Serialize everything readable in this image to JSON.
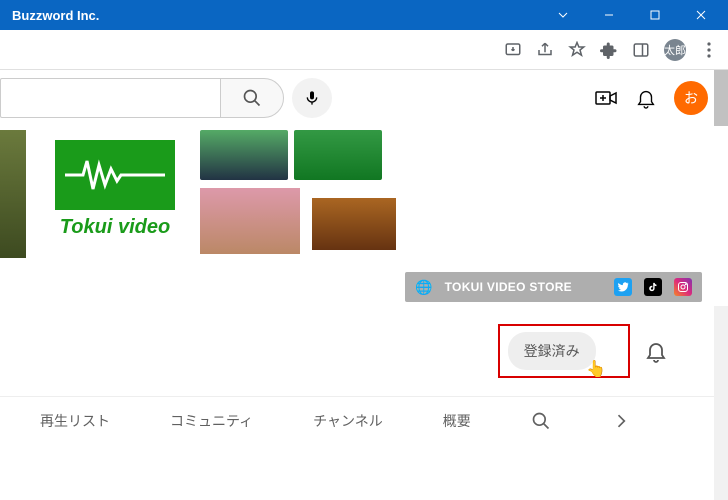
{
  "window": {
    "title": "Buzzword Inc."
  },
  "browser": {
    "profile_label": "太郎"
  },
  "youtube": {
    "avatar_label": "お",
    "channel_name": "Tokui video",
    "store_link_label": "TOKUI VIDEO STORE",
    "subscribe_button": "登録済み",
    "tabs": {
      "playlist": "再生リスト",
      "community": "コミュニティ",
      "channels": "チャンネル",
      "about": "概要"
    }
  }
}
